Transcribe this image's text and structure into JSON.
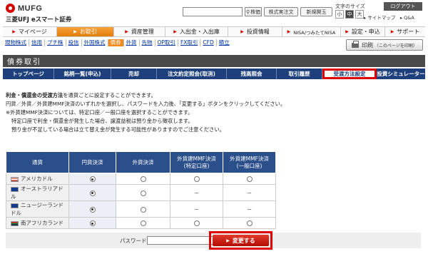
{
  "header": {
    "brand": "MUFG",
    "brand_sub": "三菱UFJ eスマート証券",
    "search_btn": "株価",
    "btn_kabushiki": "株式実注文",
    "btn_shinki": "新規開玉",
    "fontsize_label": "文字のサイズ",
    "font_small": "小",
    "font_mid": "中",
    "font_large": "大",
    "logout": "ログアウト",
    "sitemap": "▸ サイトマップ　▸ Q&A"
  },
  "gnav": [
    "マイページ",
    "お取引",
    "資産管理",
    "入出金・入出庫",
    "投資情報",
    "NISA/つみたてNISA",
    "設定・申込",
    "サポート"
  ],
  "subnav": [
    "現物株式",
    "信用",
    "プチ株",
    "投信",
    "外国株式",
    "債券",
    "外貨",
    "先物",
    "OP取引",
    "FX取引",
    "CFD",
    "積立"
  ],
  "print": {
    "label": "印刷",
    "note": "（このページを印刷）"
  },
  "page_title": "債券取引",
  "tabs": [
    "トップページ",
    "銘柄一覧(申込)",
    "売却",
    "注文約定照会(取消)",
    "残高照会",
    "取引履歴",
    "受渡方法設定",
    "投資シミュレーター"
  ],
  "desc": {
    "line1_bold": "利金・償還金の受渡方法",
    "line1_rest": "を通貨ごとに設定することができます。",
    "line2": "円貨／外貨／外貨建MMF決済のいずれかを選択し、パスワードを入力後、「変更する」ボタンをクリックしてください。",
    "line3": "※外貨建MMF決済については、特定口座／一般口座を選択することができます。",
    "line4": "特定口座で利金・償還金が発生した場合、譲渡益税は預り金から徴収します。",
    "line5": "預り金が不足している場合は立て替え金が発生する可能性がありますのでご注意ください。"
  },
  "table": {
    "headers": [
      "通貨",
      "円貨決済",
      "外貨決済",
      "外貨建MMF決済\n(特定口座)",
      "外貨建MMF決済\n(一般口座)"
    ],
    "rows": [
      {
        "currency": "アメリカドル",
        "yen": "checked",
        "foreign": "radio",
        "mmf_tokutei": "radio",
        "mmf_ippan": "radio"
      },
      {
        "currency": "オーストラリアドル",
        "yen": "checked",
        "foreign": "radio",
        "mmf_tokutei": "－",
        "mmf_ippan": "－"
      },
      {
        "currency": "ニュージーランドドル",
        "yen": "checked",
        "foreign": "radio",
        "mmf_tokutei": "－",
        "mmf_ippan": "－"
      },
      {
        "currency": "南アフリカランド",
        "yen": "checked",
        "foreign": "radio",
        "mmf_tokutei": "radio",
        "mmf_ippan": "radio"
      }
    ]
  },
  "form": {
    "password_label": "パスワード",
    "submit_label": "変更する"
  },
  "colors": {
    "accent_orange": "#f08a1c",
    "nav_blue": "#1d3f7c",
    "highlight_red": "#e00000"
  }
}
